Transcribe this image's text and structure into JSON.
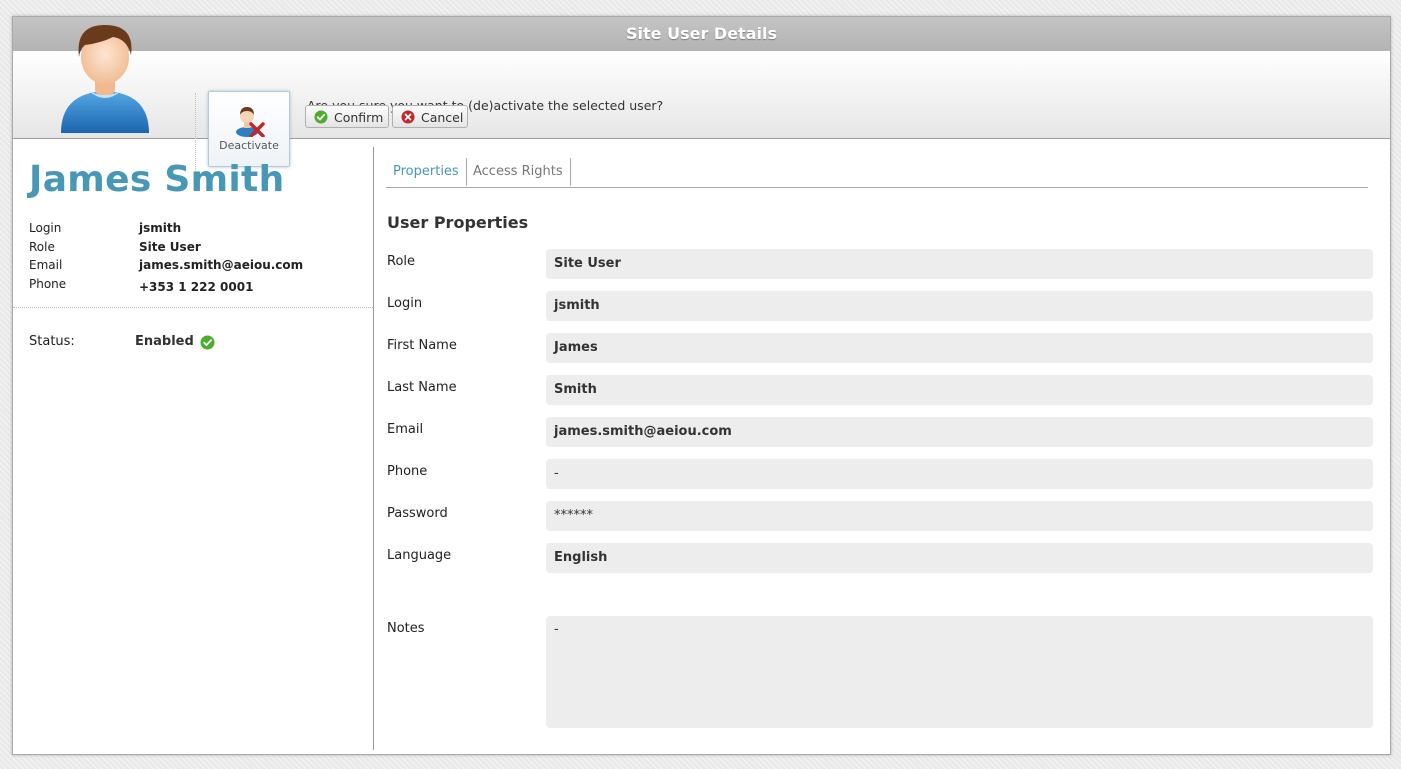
{
  "window": {
    "title": "Site User Details"
  },
  "toolbar": {
    "deactivate_label": "Deactivate",
    "confirm_message": "Are you sure you want to (de)activate the selected user?",
    "confirm_label": "Confirm",
    "cancel_label": "Cancel"
  },
  "user": {
    "name": "James Smith",
    "info": [
      {
        "key": "Login",
        "value": "jsmith"
      },
      {
        "key": "Role",
        "value": "Site User"
      },
      {
        "key": "Email",
        "value": "james.smith@aeiou.com"
      },
      {
        "key": "Phone",
        "value": "+353 1 222 0001"
      }
    ],
    "status_label": "Status:",
    "status_value": "Enabled"
  },
  "tabs": [
    {
      "label": "Properties",
      "active": true
    },
    {
      "label": "Access Rights",
      "active": false
    }
  ],
  "properties": {
    "title": "User Properties",
    "fields": [
      {
        "label": "Role",
        "value": "Site User"
      },
      {
        "label": "Login",
        "value": "jsmith"
      },
      {
        "label": "First Name",
        "value": "James"
      },
      {
        "label": "Last Name",
        "value": "Smith"
      },
      {
        "label": "Email",
        "value": "james.smith@aeiou.com"
      },
      {
        "label": "Phone",
        "value": "-"
      },
      {
        "label": "Password",
        "value": "******"
      },
      {
        "label": "Language",
        "value": "English"
      }
    ],
    "notes_label": "Notes",
    "notes_value": "-"
  },
  "icons": {
    "avatar": "user-avatar",
    "deactivate": "user-remove-icon",
    "confirm": "check-circle-icon",
    "cancel": "x-circle-icon",
    "status": "check-circle-icon"
  },
  "colors": {
    "accent": "#4797b6",
    "confirm_green": "#4cae2e",
    "cancel_red": "#c0272d",
    "title_bar": "#b9b9b9"
  }
}
